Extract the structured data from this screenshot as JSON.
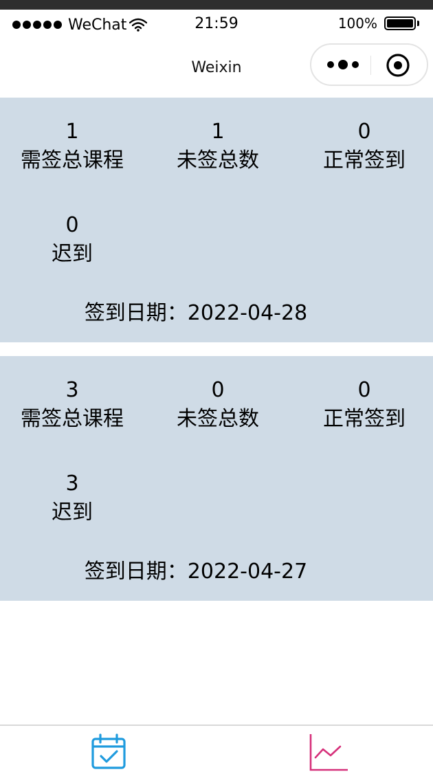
{
  "status_bar": {
    "carrier": "WeChat",
    "time": "21:59",
    "battery": "100%"
  },
  "nav": {
    "title": "Weixin"
  },
  "records": [
    {
      "stats": [
        {
          "value": "1",
          "label": "需签总课程"
        },
        {
          "value": "1",
          "label": "未签总数"
        },
        {
          "value": "0",
          "label": "正常签到"
        },
        {
          "value": "0",
          "label": "迟到"
        }
      ],
      "date": "签到日期：2022-04-28"
    },
    {
      "stats": [
        {
          "value": "3",
          "label": "需签总课程"
        },
        {
          "value": "0",
          "label": "未签总数"
        },
        {
          "value": "0",
          "label": "正常签到"
        },
        {
          "value": "3",
          "label": "迟到"
        }
      ],
      "date": "签到日期：2022-04-27"
    }
  ],
  "tab_bar": {
    "items": [
      {
        "icon": "calendar-check-icon",
        "color": "#1f9bde"
      },
      {
        "icon": "line-chart-icon",
        "color": "#d6307a"
      }
    ]
  },
  "colors": {
    "card_background": "#cfdbe6",
    "top_strip": "#2e2e2e"
  }
}
